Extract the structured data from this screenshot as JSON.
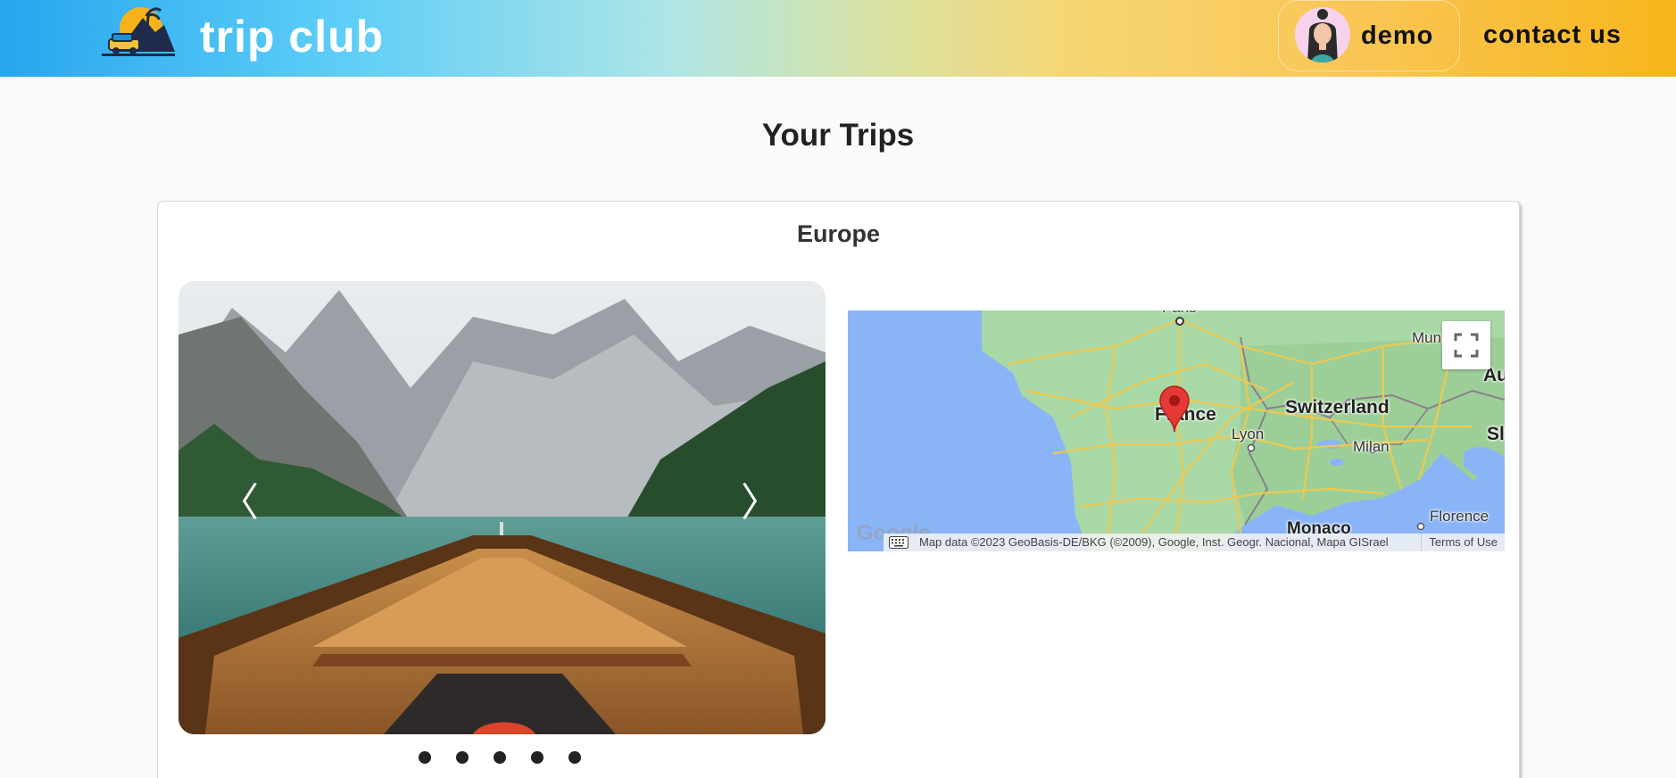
{
  "header": {
    "brand": "trip club",
    "user_name": "demo",
    "contact_label": "contact us",
    "gradient_colors": [
      "#27a6ee",
      "#5ccdf7",
      "#aee5e6",
      "#f6d673",
      "#f7b61b"
    ]
  },
  "page": {
    "title": "Your Trips"
  },
  "trip": {
    "title": "Europe",
    "carousel": {
      "prev_label": "〈",
      "next_label": "〉",
      "slide_count": 5,
      "active_slide": 1
    },
    "map": {
      "labels": {
        "paris": "Paris",
        "france": "France",
        "switzerland": "Switzerland",
        "lyon": "Lyon",
        "milan": "Milan",
        "monaco": "Monaco",
        "florence": "Florence",
        "munich": "Mun",
        "austria": "Au",
        "sl": "Sl"
      },
      "google_logo": "Google",
      "attribution": "Map data ©2023 GeoBasis-DE/BKG (©2009), Google, Inst. Geogr. Nacional, Mapa GISrael",
      "terms_label": "Terms of Use",
      "marker_color": "#e53935"
    }
  }
}
